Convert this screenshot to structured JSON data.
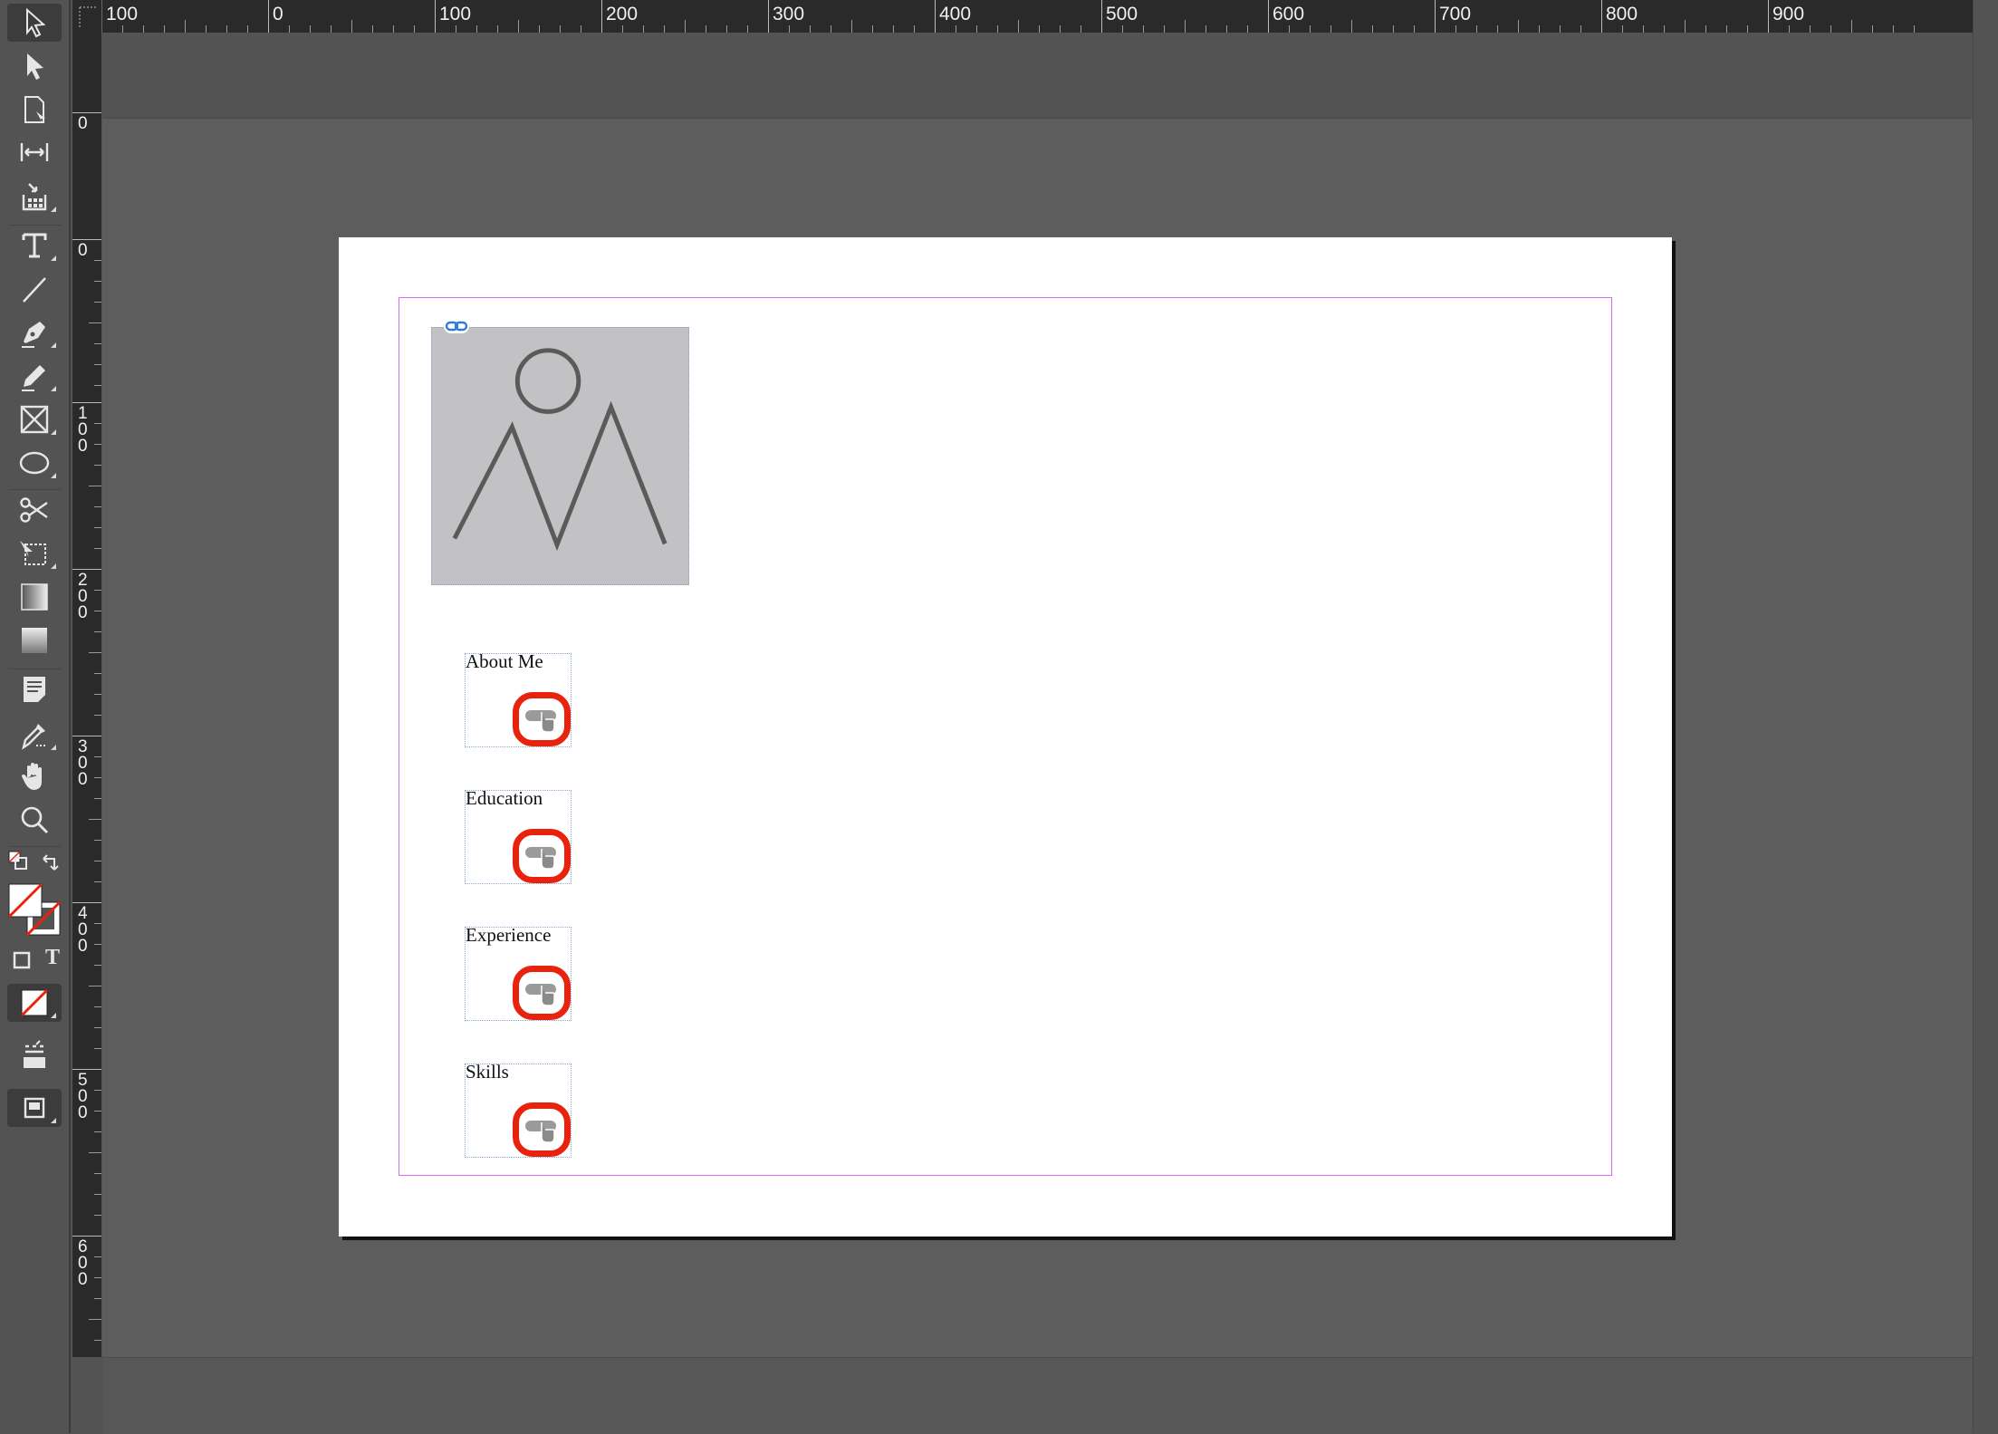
{
  "app": {
    "ruler_units": [
      "100",
      "0",
      "100",
      "200",
      "300",
      "400",
      "500",
      "600",
      "700",
      "800",
      "900"
    ],
    "vertical_ruler_units": [
      "0",
      "0",
      "100",
      "200",
      "300",
      "400",
      "500",
      "600"
    ]
  },
  "toolbar": {
    "tools": [
      {
        "name": "selection-tool",
        "icon": "arrow-outline-icon"
      },
      {
        "name": "direct-selection-tool",
        "icon": "arrow-filled-icon"
      },
      {
        "name": "page-tool",
        "icon": "page-icon"
      },
      {
        "name": "gap-tool",
        "icon": "gap-icon"
      },
      {
        "name": "content-collector-tool",
        "icon": "collector-icon"
      },
      {
        "name": "type-tool",
        "icon": "type-icon"
      },
      {
        "name": "line-tool",
        "icon": "line-icon"
      },
      {
        "name": "pen-tool",
        "icon": "pen-icon"
      },
      {
        "name": "pencil-tool",
        "icon": "pencil-icon"
      },
      {
        "name": "rectangle-frame-tool",
        "icon": "frame-x-icon"
      },
      {
        "name": "ellipse-tool",
        "icon": "ellipse-icon"
      },
      {
        "name": "scissors-tool",
        "icon": "scissors-icon"
      },
      {
        "name": "free-transform-tool",
        "icon": "transform-icon"
      },
      {
        "name": "gradient-swatch-tool",
        "icon": "gradient-icon"
      },
      {
        "name": "gradient-feather-tool",
        "icon": "feather-icon"
      },
      {
        "name": "note-tool",
        "icon": "note-icon"
      },
      {
        "name": "eyedropper-tool",
        "icon": "eyedropper-icon"
      },
      {
        "name": "hand-tool",
        "icon": "hand-icon"
      },
      {
        "name": "zoom-tool",
        "icon": "zoom-icon"
      }
    ],
    "fill_stroke": {
      "fill": "none",
      "stroke": "none"
    },
    "formatting_text_label": "T"
  },
  "page": {
    "nav_items": [
      {
        "label": "About Me"
      },
      {
        "label": "Education"
      },
      {
        "label": "Experience"
      },
      {
        "label": "Skills"
      }
    ]
  },
  "colors": {
    "margin_guide": "#d86cf0",
    "button_border": "#e8220c",
    "placeholder": "#c2c2c4",
    "link_badge": "#2f7ad8"
  }
}
